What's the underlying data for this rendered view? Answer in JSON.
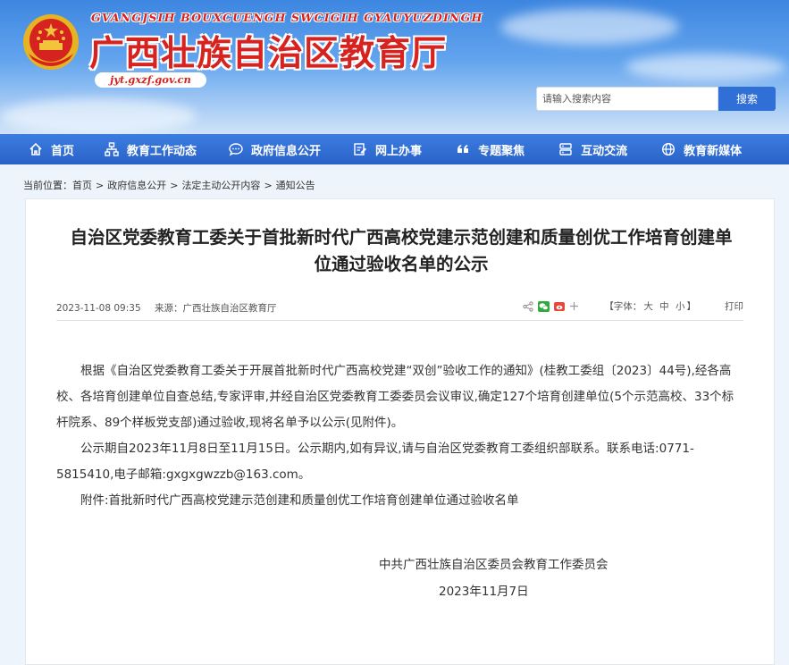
{
  "header": {
    "pinyin": "GVANGJSIH BOUXCUENGH SWCIGIH GYAUYUZDINGH",
    "title": "广西壮族自治区教育厅",
    "domain": "jyt.gxzf.gov.cn"
  },
  "search": {
    "placeholder": "请输入搜索内容",
    "button_label": "搜索"
  },
  "nav": {
    "items": [
      {
        "label": "首页",
        "icon": "home-icon"
      },
      {
        "label": "教育工作动态",
        "icon": "network-icon"
      },
      {
        "label": "政府信息公开",
        "icon": "chat-bubble-icon"
      },
      {
        "label": "网上办事",
        "icon": "document-edit-icon"
      },
      {
        "label": "专题聚焦",
        "icon": "quote-icon"
      },
      {
        "label": "互动交流",
        "icon": "server-icon"
      },
      {
        "label": "教育新媒体",
        "icon": "globe-icon"
      }
    ]
  },
  "breadcrumb": {
    "prefix": "当前位置：",
    "items": [
      "首页",
      "政府信息公开",
      "法定主动公开内容",
      "通知公告"
    ],
    "separator": ">"
  },
  "article": {
    "title": "自治区党委教育工委关于首批新时代广西高校党建示范创建和质量创优工作培育创建单位通过验收名单的公示",
    "date": "2023-11-08 09:35",
    "source": "来源：广西壮族自治区教育厅",
    "font_label_prefix": "【字体：",
    "font_large": "大",
    "font_medium": "中",
    "font_small": "小",
    "font_label_suffix": "】",
    "print_label": "打印",
    "paragraphs": [
      "根据《自治区党委教育工委关于开展首批新时代广西高校党建“双创”验收工作的通知》(桂教工委组〔2023〕44号),经各高校、各培育创建单位自查总结,专家评审,并经自治区党委教育工委委员会议审议,确定127个培育创建单位(5个示范高校、33个标杆院系、89个样板党支部)通过验收,现将名单予以公示(见附件)。",
      "公示期自2023年11月8日至11月15日。公示期内,如有异议,请与自治区党委教育工委组织部联系。联系电话:0771-5815410,电子邮箱:gxgxgwzzb@163.com。",
      "附件:首批新时代广西高校党建示范创建和质量创优工作培育创建单位通过验收名单"
    ],
    "signature": "中共广西壮族自治区委员会教育工作委员会",
    "sign_date": "2023年11月7日"
  },
  "colors": {
    "brand_red": "#d7231f",
    "nav_blue": "#2a63c8",
    "search_blue": "#2f6fd6"
  }
}
